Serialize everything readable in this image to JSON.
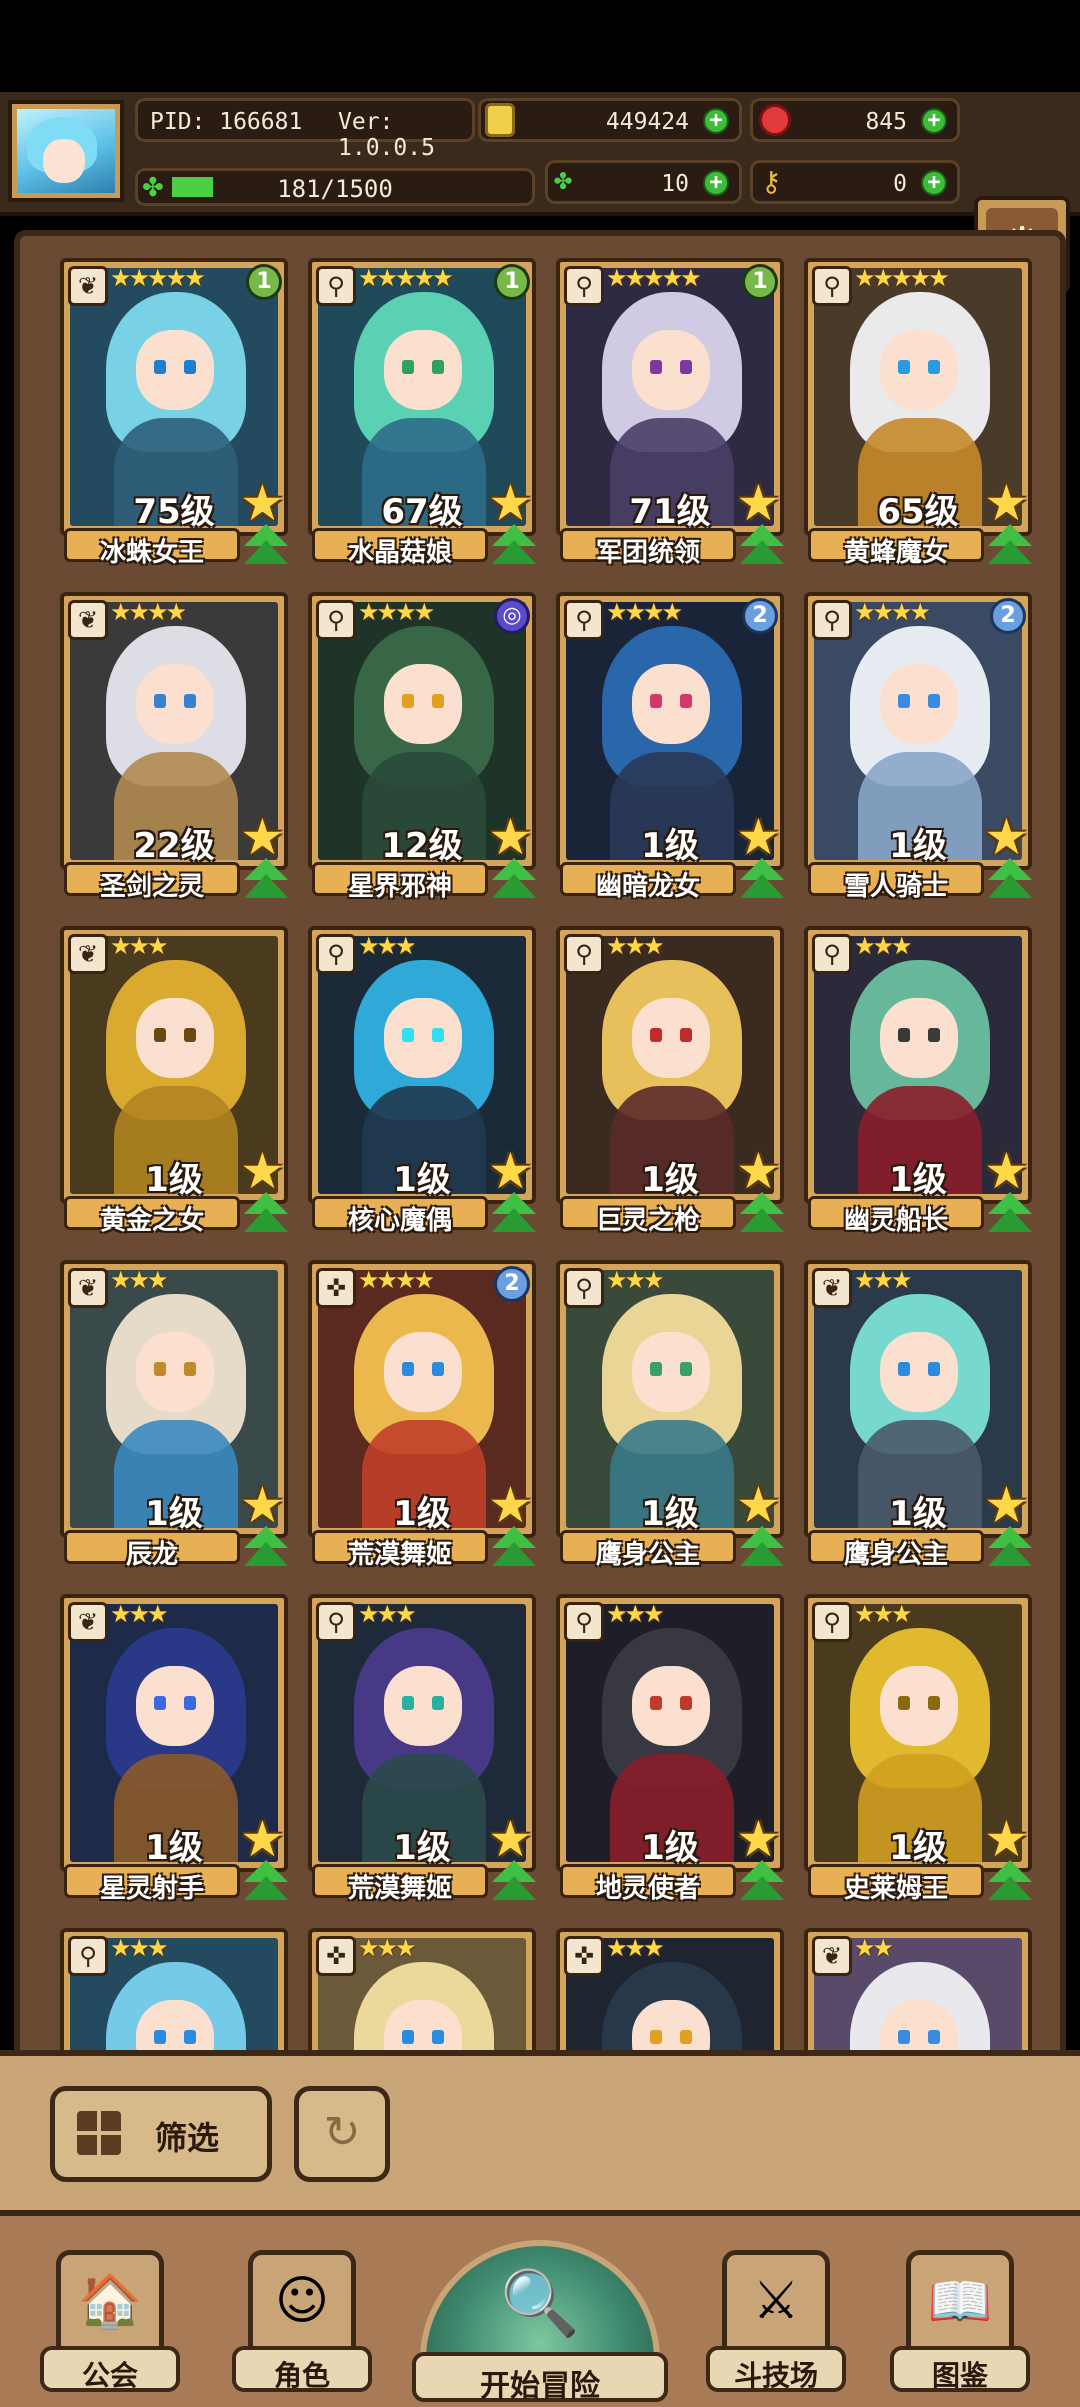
{
  "hud": {
    "pid": "PID: 166681",
    "version": "Ver: 1.0.0.5",
    "gold": "449424",
    "gems": "845",
    "exp_text": "181/1500",
    "exp_progress": 0.12,
    "clover_count": "10",
    "key_count": "0",
    "icons": {
      "gold": "gold-coin-icon",
      "gem": "red-gem-icon",
      "clover": "clover-icon",
      "key": "key-icon",
      "settings": "gear-icon"
    }
  },
  "roster": [
    {
      "name": "冰蛛女王",
      "level": "75级",
      "stars": "★★★★★",
      "badge": "1",
      "badge_color": "green",
      "hair": "#7ed8ec",
      "body": "#2f5f7a",
      "eye": "#1e7fd0",
      "bg": "#234a5e"
    },
    {
      "name": "水晶菇娘",
      "level": "67级",
      "stars": "★★★★★",
      "badge": "1",
      "badge_color": "green",
      "hair": "#5fd8b8",
      "body": "#2e6d8a",
      "eye": "#2fa060",
      "bg": "#1e4a5a"
    },
    {
      "name": "军团统领",
      "level": "71级",
      "stars": "★★★★★",
      "badge": "1",
      "badge_color": "green",
      "hair": "#d9d3ec",
      "body": "#4a3e66",
      "eye": "#7a3aa0",
      "bg": "#2e2a44"
    },
    {
      "name": "黄蜂魔女",
      "level": "65级",
      "stars": "★★★★★",
      "badge": "",
      "badge_color": "",
      "hair": "#f2f2f6",
      "body": "#c58a2a",
      "eye": "#2a9ae0",
      "bg": "#4a3a2a"
    },
    {
      "name": "圣剑之灵",
      "level": "22级",
      "stars": "★★★★",
      "badge": "",
      "badge_color": "",
      "hair": "#e6e6ee",
      "body": "#b08a50",
      "eye": "#3a7fd0",
      "bg": "#3a3a3a"
    },
    {
      "name": "星界邪神",
      "level": "12级",
      "stars": "★★★★",
      "badge": "◎",
      "badge_color": "purple",
      "hair": "#3a6a4a",
      "body": "#2a4a3a",
      "eye": "#e0a020",
      "bg": "#1e3428"
    },
    {
      "name": "幽暗龙女",
      "level": "1级",
      "stars": "★★★★",
      "badge": "2",
      "badge_color": "blue",
      "hair": "#2a6ab0",
      "body": "#2a3a5a",
      "eye": "#d03a6a",
      "bg": "#1a2438"
    },
    {
      "name": "雪人骑士",
      "level": "1级",
      "stars": "★★★★",
      "badge": "2",
      "badge_color": "blue",
      "hair": "#f0f4fa",
      "body": "#8aa6c8",
      "eye": "#3a8ae0",
      "bg": "#3a4a62"
    },
    {
      "name": "黄金之女",
      "level": "1级",
      "stars": "★★★",
      "badge": "",
      "badge_color": "",
      "hair": "#e0b030",
      "body": "#b08420",
      "eye": "#6a4a10",
      "bg": "#4a3a1e"
    },
    {
      "name": "核心魔偶",
      "level": "1级",
      "stars": "★★★",
      "badge": "",
      "badge_color": "",
      "hair": "#30b0e0",
      "body": "#203a50",
      "eye": "#30e0f0",
      "bg": "#1a2a38"
    },
    {
      "name": "巨灵之枪",
      "level": "1级",
      "stars": "★★★",
      "badge": "",
      "badge_color": "",
      "hair": "#f0c860",
      "body": "#5a2a2a",
      "eye": "#c02a2a",
      "bg": "#3a2a20"
    },
    {
      "name": "幽灵船长",
      "level": "1级",
      "stars": "★★★",
      "badge": "",
      "badge_color": "",
      "hair": "#6ac0a0",
      "body": "#8a1e2a",
      "eye": "#3a3a3a",
      "bg": "#2a2a3a"
    },
    {
      "name": "辰龙",
      "level": "1级",
      "stars": "★★★",
      "badge": "",
      "badge_color": "",
      "hair": "#efe3cf",
      "body": "#3a8ac0",
      "eye": "#c08a2a",
      "bg": "#3a4a4a"
    },
    {
      "name": "荒漠舞姬",
      "level": "1级",
      "stars": "★★★★",
      "badge": "2",
      "badge_color": "blue",
      "hair": "#f2c050",
      "body": "#c0402a",
      "eye": "#2a8ae0",
      "bg": "#5a2a20"
    },
    {
      "name": "鹰身公主",
      "level": "1级",
      "stars": "★★★",
      "badge": "",
      "badge_color": "",
      "hair": "#f2dc9a",
      "body": "#3a7a8a",
      "eye": "#3aa06a",
      "bg": "#3a4a3a"
    },
    {
      "name": "鹰身公主",
      "level": "1级",
      "stars": "★★★",
      "badge": "",
      "badge_color": "",
      "hair": "#7ae0d6",
      "body": "#4a5a6a",
      "eye": "#2a8ae0",
      "bg": "#2a3a4a"
    },
    {
      "name": "星灵射手",
      "level": "1级",
      "stars": "★★★",
      "badge": "",
      "badge_color": "",
      "hair": "#2a3a8a",
      "body": "#8a5a2a",
      "eye": "#3a6ae0",
      "bg": "#1e2a4a"
    },
    {
      "name": "荒漠舞姬",
      "level": "1级",
      "stars": "★★★",
      "badge": "",
      "badge_color": "",
      "hair": "#4a3a8a",
      "body": "#2a4a4a",
      "eye": "#2ab0a0",
      "bg": "#1e2a3a"
    },
    {
      "name": "地灵使者",
      "level": "1级",
      "stars": "★★★",
      "badge": "",
      "badge_color": "",
      "hair": "#3a3a44",
      "body": "#8a1e2a",
      "eye": "#c03a2a",
      "bg": "#1e1e28"
    },
    {
      "name": "史莱姆王",
      "level": "1级",
      "stars": "★★★",
      "badge": "",
      "badge_color": "",
      "hair": "#e8c030",
      "body": "#d0a020",
      "eye": "#8a6a10",
      "bg": "#4a3a1e"
    },
    {
      "name": "",
      "level": "",
      "stars": "★★★",
      "badge": "",
      "badge_color": "",
      "hair": "#7ad0f0",
      "body": "#2a5a8a",
      "eye": "#2a8ae0",
      "bg": "#234a5e"
    },
    {
      "name": "",
      "level": "",
      "stars": "★★★",
      "badge": "",
      "badge_color": "",
      "hair": "#f2e0a0",
      "body": "#c0a060",
      "eye": "#2a8ae0",
      "bg": "#6a5a3a"
    },
    {
      "name": "",
      "level": "",
      "stars": "★★★",
      "badge": "",
      "badge_color": "",
      "hair": "#2a3a4a",
      "body": "#2a2a3a",
      "eye": "#e0a020",
      "bg": "#1e2430"
    },
    {
      "name": "",
      "level": "",
      "stars": "★★",
      "badge": "",
      "badge_color": "",
      "hair": "#f0f0f4",
      "body": "#8a8aa0",
      "eye": "#3a8ae0",
      "bg": "#5a4a6a"
    }
  ],
  "controls": {
    "filter_label": "筛选",
    "filter_icon": "grid-filter-icon",
    "refresh_icon": "refresh-icon"
  },
  "nav": {
    "guild": "公会",
    "character": "角色",
    "adventure": "开始冒险",
    "arena": "斗技场",
    "codex": "图鉴"
  }
}
